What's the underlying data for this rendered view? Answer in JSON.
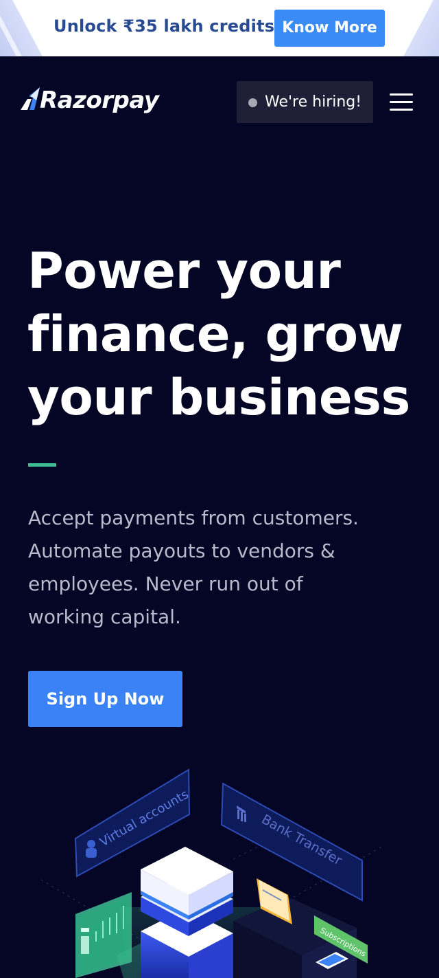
{
  "promo": {
    "text": "Unlock ₹35 lakh credits",
    "button": "Know More"
  },
  "nav": {
    "logo": "Razorpay",
    "hiring": "We're hiring!",
    "menu_icon": "hamburger-menu-icon"
  },
  "hero": {
    "title_lines": [
      "Power your",
      "finance, grow",
      "your business"
    ],
    "subtitle_lines": [
      "Accept payments from customers.",
      "Automate payouts to vendors &",
      "employees. Never run out of",
      "working capital."
    ],
    "cta": "Sign Up Now"
  },
  "illustration": {
    "labels": {
      "virtual_accounts": "Virtual accounts",
      "bank_transfer": "Bank Transfer",
      "subscriptions": "Subscriptions"
    }
  },
  "colors": {
    "background": "#050525",
    "primary_blue": "#3b82f6",
    "promo_text": "#274a92",
    "accent_green": "#3ebd93"
  }
}
